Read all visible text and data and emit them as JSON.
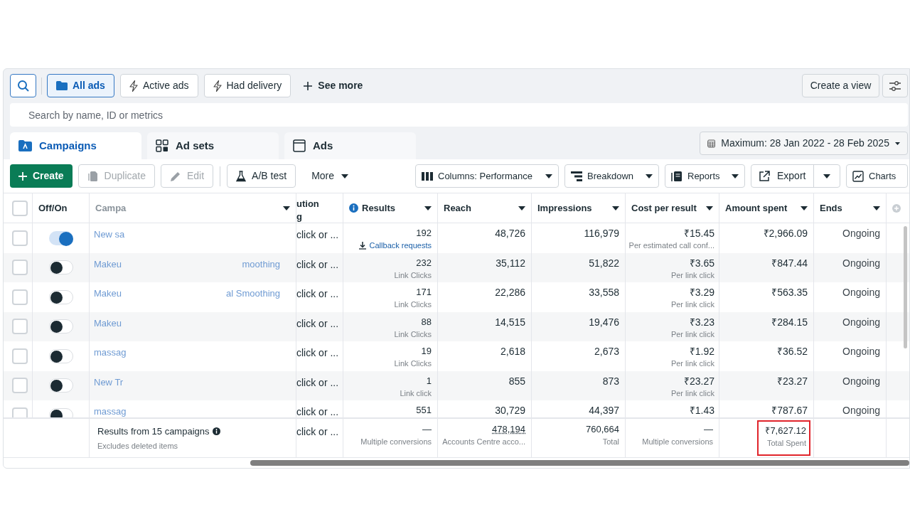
{
  "filters": {
    "chips": [
      {
        "label": "All ads",
        "selected": true
      },
      {
        "label": "Active ads",
        "selected": false
      },
      {
        "label": "Had delivery",
        "selected": false
      }
    ],
    "see_more": "See more",
    "create_view": "Create a view"
  },
  "search": {
    "placeholder": "Search by name, ID or metrics"
  },
  "tabs": [
    {
      "label": "Campaigns",
      "selected": true
    },
    {
      "label": "Ad sets",
      "selected": false
    },
    {
      "label": "Ads",
      "selected": false
    }
  ],
  "date_range": "Maximum: 28 Jan 2022 - 28 Feb 2025",
  "toolbar": {
    "left": [
      {
        "label": "Create",
        "kind": "primary",
        "disabled": false
      },
      {
        "label": "Duplicate",
        "kind": "plain",
        "disabled": true
      },
      {
        "label": "Edit",
        "kind": "plain",
        "disabled": true
      },
      {
        "label": "A/B test",
        "kind": "plain",
        "disabled": false
      }
    ],
    "more": "More",
    "right": [
      {
        "label": "Columns: Performance",
        "kind": "menu"
      },
      {
        "label": "Breakdown",
        "kind": "menu"
      },
      {
        "label": "Reports",
        "kind": "menu"
      },
      {
        "label": "Export",
        "kind": "split"
      },
      {
        "label": "Charts",
        "kind": "plain"
      }
    ]
  },
  "table": {
    "select_all_checked": false,
    "columns": [
      "Off/On",
      "Campa",
      "ution g",
      "Results",
      "Reach",
      "Impressions",
      "Cost per result",
      "Amount spent",
      "Ends"
    ],
    "rows": [
      {
        "checked": false,
        "on": true,
        "campaign": [
          "New sa"
        ],
        "attribution": "click or ...",
        "results": {
          "value": "192",
          "label": "Callback requests",
          "kind": "link"
        },
        "reach": "48,726",
        "impressions": "116,979",
        "cost": "₹15.45",
        "cost_label": "Per estimated call conf...",
        "spent": "₹2,966.09",
        "ends": "Ongoing"
      },
      {
        "checked": false,
        "on": false,
        "campaign": [
          "Makeu",
          "moothing"
        ],
        "attribution": "click or ...",
        "results": {
          "value": "232",
          "label": "Link Clicks",
          "kind": "plain"
        },
        "reach": "35,112",
        "impressions": "51,822",
        "cost": "₹3.65",
        "cost_label": "Per link click",
        "spent": "₹847.44",
        "ends": "Ongoing"
      },
      {
        "checked": false,
        "on": false,
        "campaign": [
          "Makeu",
          "al Smoothing"
        ],
        "attribution": "click or ...",
        "results": {
          "value": "171",
          "label": "Link Clicks",
          "kind": "plain"
        },
        "reach": "22,286",
        "impressions": "33,558",
        "cost": "₹3.29",
        "cost_label": "Per link click",
        "spent": "₹563.35",
        "ends": "Ongoing"
      },
      {
        "checked": false,
        "on": false,
        "campaign": [
          "Makeu"
        ],
        "attribution": "click or ...",
        "results": {
          "value": "88",
          "label": "Link Clicks",
          "kind": "plain"
        },
        "reach": "14,515",
        "impressions": "19,476",
        "cost": "₹3.23",
        "cost_label": "Per link click",
        "spent": "₹284.15",
        "ends": "Ongoing"
      },
      {
        "checked": false,
        "on": false,
        "campaign": [
          "massag"
        ],
        "attribution": "click or ...",
        "results": {
          "value": "19",
          "label": "Link Clicks",
          "kind": "plain"
        },
        "reach": "2,618",
        "impressions": "2,673",
        "cost": "₹1.92",
        "cost_label": "Per link click",
        "spent": "₹36.52",
        "ends": "Ongoing"
      },
      {
        "checked": false,
        "on": false,
        "campaign": [
          "New Tr"
        ],
        "attribution": "click or ...",
        "results": {
          "value": "1",
          "label": "Link click",
          "kind": "plain"
        },
        "reach": "855",
        "impressions": "873",
        "cost": "₹23.27",
        "cost_label": "Per link click",
        "spent": "₹23.27",
        "ends": "Ongoing"
      },
      {
        "checked": false,
        "on": false,
        "campaign": [
          "massag"
        ],
        "attribution": "click or ...",
        "results": {
          "value": "551"
        },
        "reach": "30,729",
        "impressions": "44,397",
        "cost": "₹1.43",
        "spent": "₹787.67",
        "ends": "Ongoing"
      }
    ],
    "footer": {
      "title": "Results from 15 campaigns",
      "subtitle": "Excludes deleted items",
      "attribution": "click or ...",
      "cells": [
        {
          "value": "—",
          "label": "Multiple conversions",
          "underlined": false,
          "highlighted": false
        },
        {
          "value": "478,194",
          "label": "Accounts Centre acco...",
          "underlined": true,
          "highlighted": false
        },
        {
          "value": "760,664",
          "label": "Total",
          "underlined": false,
          "highlighted": false
        },
        {
          "value": "—",
          "label": "Multiple conversions",
          "underlined": false,
          "highlighted": false
        },
        {
          "value": "₹7,627.12",
          "label": "Total Spent",
          "underlined": false,
          "highlighted": true
        }
      ]
    }
  }
}
